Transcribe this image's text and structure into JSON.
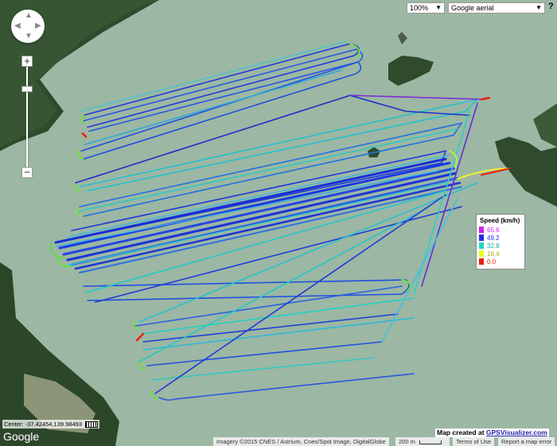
{
  "map_type_select": {
    "zoom_value": "100%",
    "layer_value": "Google aerial"
  },
  "help": "?",
  "zoom": {
    "in_label": "+",
    "out_label": "−"
  },
  "legend": {
    "title": "Speed (km/h)",
    "items": [
      {
        "label": "65.6",
        "color": "#d020f0"
      },
      {
        "label": "49.2",
        "color": "#2030e0"
      },
      {
        "label": "32.8",
        "color": "#20d8c8"
      },
      {
        "label": "16.4",
        "color": "#e8ff20"
      },
      {
        "label": "0.0",
        "color": "#e82010"
      }
    ]
  },
  "center_readout": "Center: -37.42454,139.98493",
  "scale_icon": "ruler-icon",
  "google_logo": "Google",
  "credit": {
    "prefix": "Map created at ",
    "link": "GPSVisualizer.com"
  },
  "footer": {
    "imagery": "Imagery ©2015 CNES / Astrium, Cnes/Spot Image, DigitalGlobe",
    "scale": "200 m",
    "terms": "Terms of Use",
    "report": "Report a map error"
  },
  "colors": {
    "water": "#9fb8a5",
    "land": "#2f4a2c",
    "track_blue": "#1f3ad8",
    "track_cyan": "#2ad0c8",
    "track_green": "#6ad84a",
    "track_red": "#e82010"
  }
}
